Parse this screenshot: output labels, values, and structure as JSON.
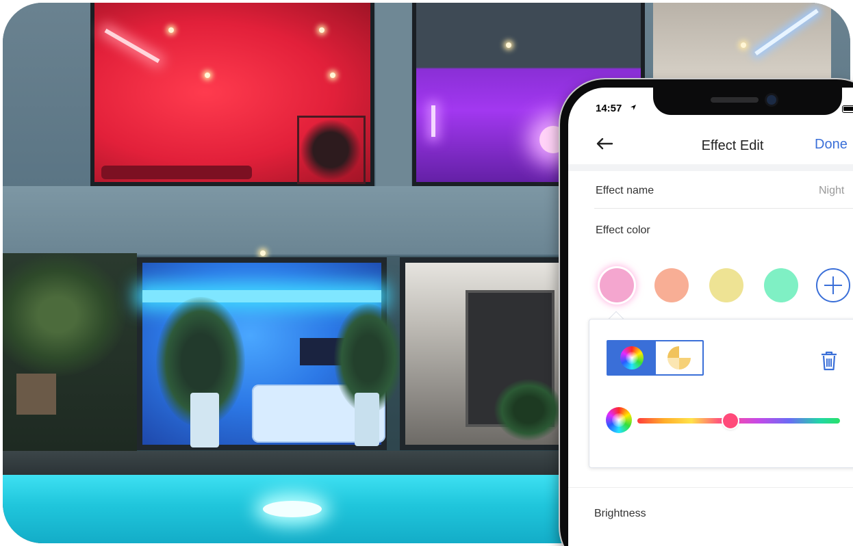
{
  "status_bar": {
    "time": "14:57"
  },
  "nav": {
    "title": "Effect Edit",
    "done_label": "Done"
  },
  "effect_name": {
    "label": "Effect name",
    "value": "Night"
  },
  "effect_color": {
    "label": "Effect color",
    "swatches": [
      {
        "color": "#f4a6cf",
        "selected": true
      },
      {
        "color": "#f8ae95",
        "selected": false
      },
      {
        "color": "#eee394",
        "selected": false
      },
      {
        "color": "#7ff0c4",
        "selected": false
      }
    ],
    "accent_color": "#3a6fd8"
  },
  "color_editor": {
    "modes": [
      "color-wheel-mode",
      "warm-white-mode"
    ],
    "active_mode": 0,
    "hue_position": 0.46
  },
  "brightness": {
    "label": "Brightness"
  }
}
